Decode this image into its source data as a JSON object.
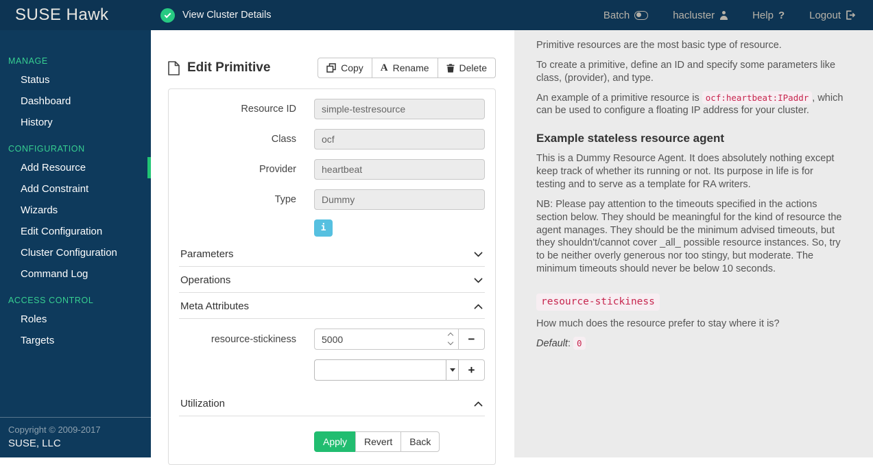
{
  "colors": {
    "topbar_navy": "#0d3453",
    "sidebar_navy": "#0e3a5c",
    "accent_green": "#21bd70",
    "heading_green": "#37d091",
    "info_blue": "#56c0e0",
    "code_red": "#c7254e"
  },
  "topbar": {
    "brand": "SUSE Hawk",
    "status_label": "View Cluster Details",
    "nav": [
      {
        "label": "Batch",
        "icon": "toggle-icon"
      },
      {
        "label": "hacluster",
        "icon": "user-icon"
      },
      {
        "label": "Help",
        "icon": "question-icon"
      },
      {
        "label": "Logout",
        "icon": "logout-icon"
      }
    ]
  },
  "sidebar": {
    "sections": [
      {
        "heading": "MANAGE",
        "items": [
          {
            "label": "Status"
          },
          {
            "label": "Dashboard"
          },
          {
            "label": "History"
          }
        ]
      },
      {
        "heading": "CONFIGURATION",
        "items": [
          {
            "label": "Add Resource",
            "active": true
          },
          {
            "label": "Add Constraint"
          },
          {
            "label": "Wizards"
          },
          {
            "label": "Edit Configuration"
          },
          {
            "label": "Cluster Configuration"
          },
          {
            "label": "Command Log"
          }
        ]
      },
      {
        "heading": "ACCESS CONTROL",
        "items": [
          {
            "label": "Roles"
          },
          {
            "label": "Targets"
          }
        ]
      }
    ],
    "copyright_line1": "Copyright © 2009-2017",
    "copyright_line2": "SUSE, LLC"
  },
  "main": {
    "title": "Edit Primitive",
    "toolbar": {
      "copy": "Copy",
      "rename": "Rename",
      "delete": "Delete"
    },
    "form": {
      "fields": [
        {
          "label": "Resource ID",
          "value": "simple-testresource"
        },
        {
          "label": "Class",
          "value": "ocf"
        },
        {
          "label": "Provider",
          "value": "heartbeat"
        },
        {
          "label": "Type",
          "value": "Dummy"
        }
      ],
      "info_label": "i",
      "sections": [
        {
          "label": "Parameters",
          "state": "collapsed"
        },
        {
          "label": "Operations",
          "state": "collapsed"
        },
        {
          "label": "Meta Attributes",
          "state": "expanded"
        }
      ],
      "meta": {
        "attr_label": "resource-stickiness",
        "attr_value": "5000",
        "remove_label": "−",
        "add_label": "+",
        "new_attr_value": ""
      },
      "utilization_label": "Utilization",
      "footer": {
        "apply": "Apply",
        "revert": "Revert",
        "back": "Back"
      }
    }
  },
  "help_panel": {
    "p1": "Primitive resources are the most basic type of resource.",
    "p2": "To create a primitive, define an ID and specify some parameters like class, (provider), and type.",
    "p3_before": "An example of a primitive resource is ",
    "p3_code": "ocf:heartbeat:IPaddr",
    "p3_after": ", which can be used to configure a floating IP address for your cluster.",
    "example_heading": "Example stateless resource agent",
    "p4": "This is a Dummy Resource Agent. It does absolutely nothing except keep track of whether its running or not. Its purpose in life is for testing and to serve as a template for RA writers.",
    "p5": "NB: Please pay attention to the timeouts specified in the actions section below. They should be meaningful for the kind of resource the agent manages. They should be the minimum advised timeouts, but they shouldn't/cannot cover _all_ possible resource instances. So, try to be neither overly generous nor too stingy, but moderate. The minimum timeouts should never be below 10 seconds.",
    "stickiness_code": "resource-stickiness",
    "p6": "How much does the resource prefer to stay where it is?",
    "default_label": "Default",
    "default_sep": ":",
    "default_value": "0"
  }
}
